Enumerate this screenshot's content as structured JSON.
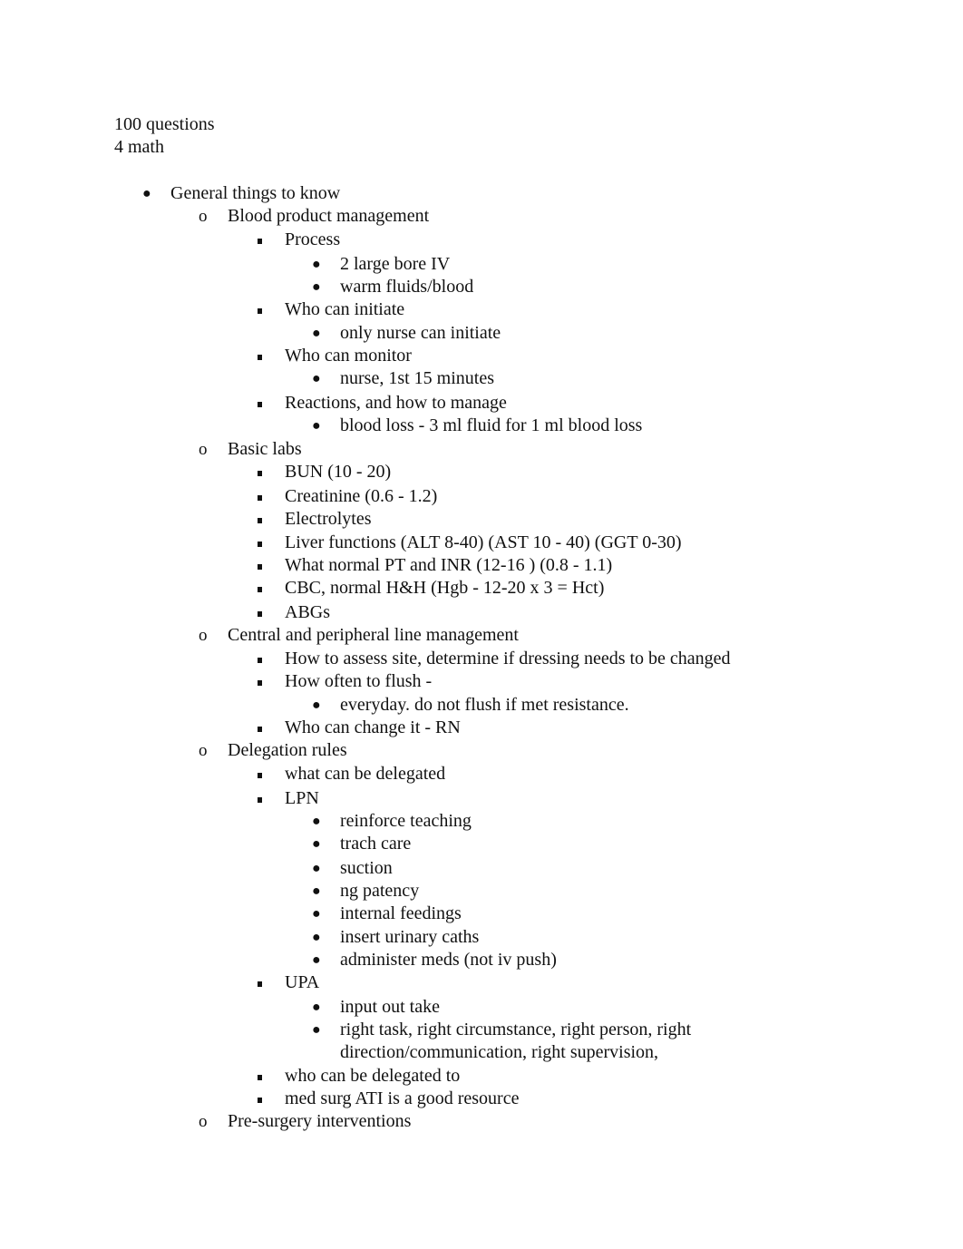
{
  "document": {
    "header_lines": [
      "100 questions",
      "4 math"
    ],
    "outline": [
      {
        "level": 1,
        "text": "General things to know"
      },
      {
        "level": 2,
        "text": "Blood product management"
      },
      {
        "level": 3,
        "text": "Process"
      },
      {
        "level": 4,
        "text": "2 large bore IV"
      },
      {
        "level": 4,
        "text": "warm fluids/blood"
      },
      {
        "level": 3,
        "text": "Who can initiate"
      },
      {
        "level": 4,
        "text": "only nurse can initiate"
      },
      {
        "level": 3,
        "text": "Who can monitor"
      },
      {
        "level": 4,
        "text": "nurse, 1st 15 minutes"
      },
      {
        "level": 3,
        "text": "Reactions, and how to manage"
      },
      {
        "level": 4,
        "text": "blood loss - 3 ml fluid for 1 ml blood loss"
      },
      {
        "level": 2,
        "text": "Basic labs"
      },
      {
        "level": 3,
        "text": "BUN (10 - 20)"
      },
      {
        "level": 3,
        "text": "Creatinine (0.6 - 1.2)"
      },
      {
        "level": 3,
        "text": "Electrolytes"
      },
      {
        "level": 3,
        "text": "Liver functions (ALT 8-40) (AST 10 - 40) (GGT 0-30)"
      },
      {
        "level": 3,
        "text": "What normal PT and INR (12-16 ) (0.8 - 1.1)"
      },
      {
        "level": 3,
        "text": "CBC, normal H&H (Hgb - 12-20 x 3 = Hct)"
      },
      {
        "level": 3,
        "text": "ABGs"
      },
      {
        "level": 2,
        "text": "Central and peripheral line management"
      },
      {
        "level": 3,
        "text": "How to assess site, determine if dressing needs to be changed"
      },
      {
        "level": 3,
        "text": "How often to flush -"
      },
      {
        "level": 4,
        "text": "everyday. do not flush if met resistance."
      },
      {
        "level": 3,
        "text": "Who can change it - RN"
      },
      {
        "level": 2,
        "text": "Delegation rules"
      },
      {
        "level": 3,
        "text": "what can be delegated"
      },
      {
        "level": 3,
        "text": "LPN"
      },
      {
        "level": 4,
        "text": "reinforce teaching"
      },
      {
        "level": 4,
        "text": "trach care"
      },
      {
        "level": 4,
        "text": "suction"
      },
      {
        "level": 4,
        "text": "ng patency"
      },
      {
        "level": 4,
        "text": "internal feedings"
      },
      {
        "level": 4,
        "text": "insert urinary caths"
      },
      {
        "level": 4,
        "text": "administer meds (not iv push)"
      },
      {
        "level": 3,
        "text": "UPA"
      },
      {
        "level": 4,
        "text": "input out take"
      },
      {
        "level": 4,
        "text": "right task, right circumstance, right person, right",
        "continuation": "direction/communication, right supervision,"
      },
      {
        "level": 3,
        "text": "who can be delegated to"
      },
      {
        "level": 3,
        "text": "med surg ATI is a good resource"
      },
      {
        "level": 2,
        "text": "Pre-surgery interventions"
      }
    ]
  }
}
